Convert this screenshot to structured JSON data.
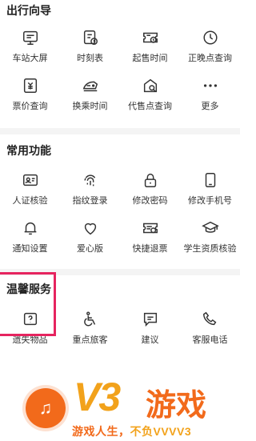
{
  "sections": [
    {
      "title": "出行向导",
      "items": [
        {
          "label": "车站大屏",
          "icon": "monitor-icon"
        },
        {
          "label": "时刻表",
          "icon": "schedule-icon"
        },
        {
          "label": "起售时间",
          "icon": "ticket-clock-icon"
        },
        {
          "label": "正晚点查询",
          "icon": "clock-icon"
        },
        {
          "label": "票价查询",
          "icon": "price-icon"
        },
        {
          "label": "换乘时间",
          "icon": "train-icon"
        },
        {
          "label": "代售点查询",
          "icon": "agency-icon"
        },
        {
          "label": "更多",
          "icon": "more-icon"
        }
      ]
    },
    {
      "title": "常用功能",
      "items": [
        {
          "label": "人证核验",
          "icon": "id-card-icon"
        },
        {
          "label": "指纹登录",
          "icon": "fingerprint-icon"
        },
        {
          "label": "修改密码",
          "icon": "lock-icon"
        },
        {
          "label": "修改手机号",
          "icon": "phone-icon"
        },
        {
          "label": "通知设置",
          "icon": "bell-icon"
        },
        {
          "label": "爱心版",
          "icon": "heart-icon"
        },
        {
          "label": "快捷退票",
          "icon": "refund-icon"
        },
        {
          "label": "学生资质核验",
          "icon": "graduation-cap-icon"
        }
      ]
    },
    {
      "title": "温馨服务",
      "items": [
        {
          "label": "遗失物品",
          "icon": "lost-item-icon"
        },
        {
          "label": "重点旅客",
          "icon": "wheelchair-icon"
        },
        {
          "label": "建议",
          "icon": "feedback-icon"
        },
        {
          "label": "客服电话",
          "icon": "phone-call-icon"
        }
      ]
    }
  ],
  "watermark": {
    "brand": "V3",
    "brand_cn": "游戏",
    "slogan_a": "游戏人生，",
    "slogan_b": "不负VVVV3"
  },
  "colors": {
    "highlight": "#e6245f",
    "watermark_orange": "#f26a1b",
    "watermark_yellow": "#f2a21b"
  }
}
